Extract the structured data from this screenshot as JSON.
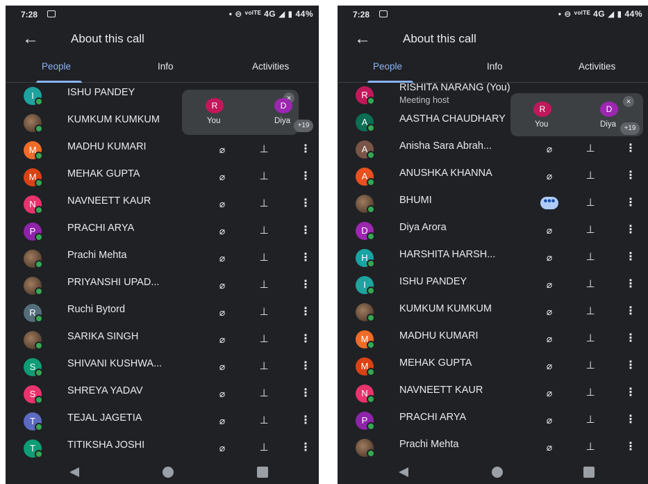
{
  "status": {
    "time": "7:28",
    "right": "• ⊖ ᵛᵒˡᵀᴱ 4G ◢ ▮ 44%"
  },
  "header": {
    "title": "About this call",
    "back_icon": "arrow-back-icon"
  },
  "tabs": [
    "People",
    "Info",
    "Activities"
  ],
  "colors": {
    "bg": "#202124",
    "accent": "#8ab4f8",
    "online": "#34a853"
  },
  "left": {
    "overlay": {
      "you_initial": "R",
      "you_label": "You",
      "other_initial": "D",
      "other_label": "Diya",
      "more": "+19"
    },
    "participants": [
      {
        "initial": "I",
        "name": "ISHU PANDEY",
        "color": "#1ea39f",
        "photo": false
      },
      {
        "initial": "",
        "name": "KUMKUM KUMKUM",
        "color": "",
        "photo": true
      },
      {
        "initial": "M",
        "name": "MADHU KUMARI",
        "color": "#ef6c28",
        "photo": false
      },
      {
        "initial": "M",
        "name": "MEHAK GUPTA",
        "color": "#d84315",
        "photo": false
      },
      {
        "initial": "N",
        "name": "NAVNEETT KAUR",
        "color": "#e8336d",
        "photo": false
      },
      {
        "initial": "P",
        "name": "PRACHI ARYA",
        "color": "#8e24aa",
        "photo": false
      },
      {
        "initial": "",
        "name": "Prachi Mehta",
        "color": "",
        "photo": true
      },
      {
        "initial": "",
        "name": "PRIYANSHI UPAD...",
        "color": "",
        "photo": true
      },
      {
        "initial": "R",
        "name": "Ruchi Bytord",
        "color": "#546e7a",
        "photo": false
      },
      {
        "initial": "",
        "name": "SARIKA SINGH",
        "color": "",
        "photo": true
      },
      {
        "initial": "S",
        "name": "SHIVANI KUSHWA...",
        "color": "#0f9d77",
        "photo": false
      },
      {
        "initial": "S",
        "name": "SHREYA YADAV",
        "color": "#e8336d",
        "photo": false
      },
      {
        "initial": "T",
        "name": "TEJAL JAGETIA",
        "color": "#5c6bc0",
        "photo": false
      },
      {
        "initial": "T",
        "name": "TITIKSHA JOSHI",
        "color": "#0f9d77",
        "photo": false
      }
    ]
  },
  "right": {
    "overlay": {
      "you_initial": "R",
      "you_label": "You",
      "other_initial": "D",
      "other_label": "Diya",
      "more": "+19"
    },
    "participants": [
      {
        "initial": "R",
        "name": "RISHITA NARANG (You)",
        "sub": "Meeting host",
        "color": "#c2185b",
        "photo": false
      },
      {
        "initial": "A",
        "name": "AASTHA CHAUDHARY",
        "color": "#0b6e55",
        "photo": false
      },
      {
        "initial": "A",
        "name": "Anisha Sara Abrah...",
        "color": "#795548",
        "photo": false
      },
      {
        "initial": "A",
        "name": "ANUSHKA KHANNA",
        "color": "#e8501f",
        "photo": false
      },
      {
        "initial": "",
        "name": "BHUMI",
        "color": "",
        "photo": true,
        "speaking": true
      },
      {
        "initial": "D",
        "name": "Diya Arora",
        "color": "#9c27b0",
        "photo": false
      },
      {
        "initial": "H",
        "name": "HARSHITA HARSH...",
        "color": "#1aa3a3",
        "photo": false
      },
      {
        "initial": "I",
        "name": "ISHU PANDEY",
        "color": "#1ea39f",
        "photo": false
      },
      {
        "initial": "",
        "name": "KUMKUM KUMKUM",
        "color": "",
        "photo": true
      },
      {
        "initial": "M",
        "name": "MADHU KUMARI",
        "color": "#ef6c28",
        "photo": false
      },
      {
        "initial": "M",
        "name": "MEHAK GUPTA",
        "color": "#d84315",
        "photo": false
      },
      {
        "initial": "N",
        "name": "NAVNEETT KAUR",
        "color": "#e8336d",
        "photo": false
      },
      {
        "initial": "P",
        "name": "PRACHI ARYA",
        "color": "#8e24aa",
        "photo": false
      },
      {
        "initial": "",
        "name": "Prachi Mehta",
        "color": "",
        "photo": true
      }
    ]
  }
}
